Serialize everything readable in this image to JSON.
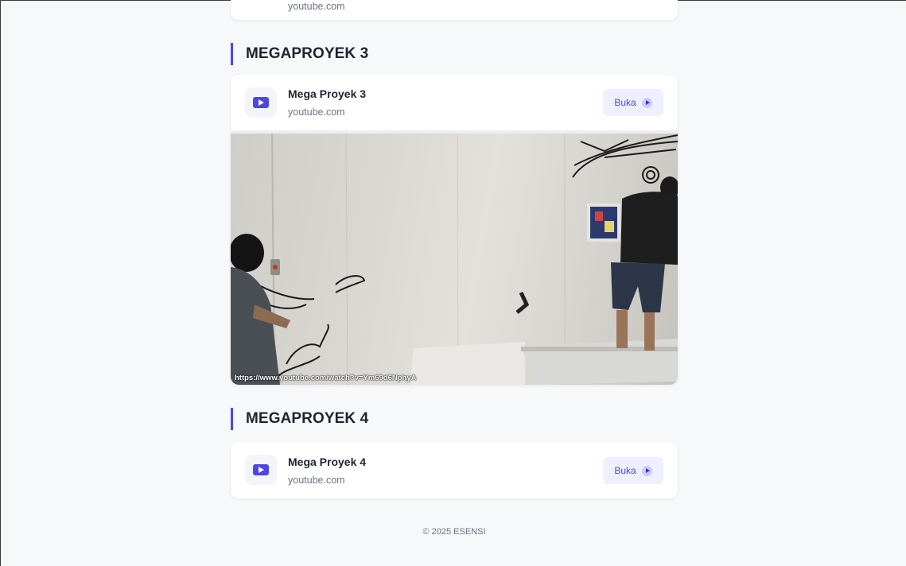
{
  "top_card": {
    "subtitle": "youtube.com"
  },
  "sections": [
    {
      "heading": "MEGAPROYEK 3",
      "card": {
        "title": "Mega Proyek 3",
        "subtitle": "youtube.com",
        "button_label": "Buka",
        "icon": "youtube-play-icon"
      },
      "video": {
        "url_overlay": "https://www.youtube.com/watch?v=Ym69d6NphyA"
      }
    },
    {
      "heading": "MEGAPROYEK 4",
      "card": {
        "title": "Mega Proyek 4",
        "subtitle": "youtube.com",
        "button_label": "Buka",
        "icon": "youtube-play-icon"
      }
    }
  ],
  "footer": {
    "text": "© 2025 ESENSI"
  },
  "colors": {
    "accent": "#4f46e5",
    "button_bg": "#eef0fd",
    "page_bg": "#f7f8fa"
  }
}
